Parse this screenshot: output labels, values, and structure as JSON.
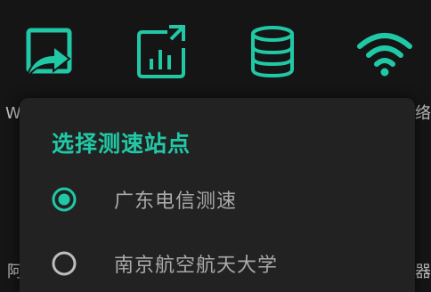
{
  "theme": {
    "accent": "#21c8a6",
    "background": "#151515",
    "dialog_background": "#222222",
    "text_muted": "#a9a9a9"
  },
  "toolbar": {
    "icons": [
      "share-icon",
      "chart-icon",
      "database-icon",
      "wifi-icon"
    ]
  },
  "background_text": {
    "left_top": "W",
    "right_top": "络",
    "left_bottom": "阿",
    "right_bottom": "器"
  },
  "dialog": {
    "title": "选择测速站点",
    "options": [
      {
        "label": "广东电信测速",
        "selected": true
      },
      {
        "label": "南京航空航天大学",
        "selected": false
      }
    ]
  }
}
